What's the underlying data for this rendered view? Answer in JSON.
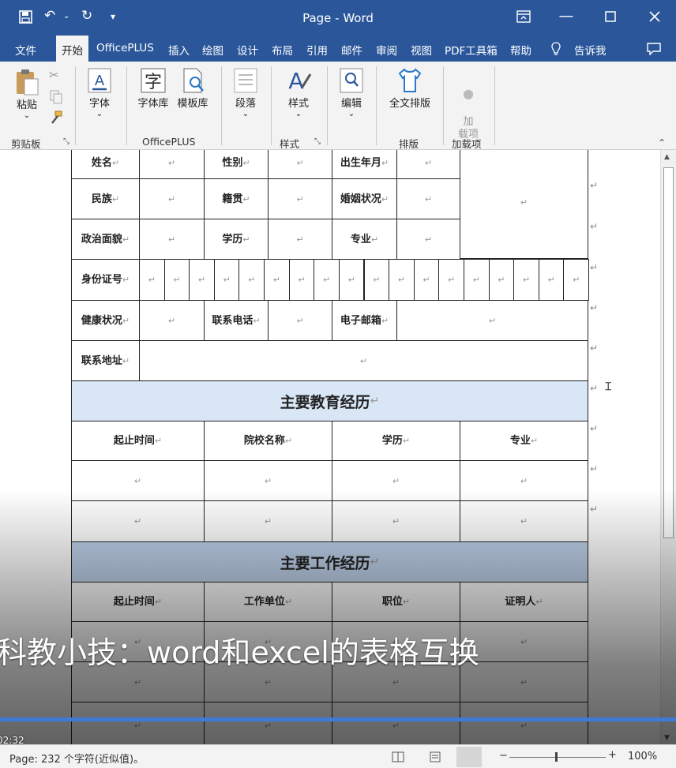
{
  "titlebar": {
    "title": "Page - Word",
    "save_icon": "save-icon",
    "undo_icon": "undo-icon",
    "redo_icon": "redo-icon",
    "customize_icon": "customize-qat-icon",
    "ribbon_display_icon": "ribbon-display-options-icon",
    "minimize_icon": "minimize-icon",
    "maximize_icon": "maximize-icon",
    "close_icon": "close-icon"
  },
  "tabs": [
    "文件",
    "开始",
    "OfficePLUS",
    "插入",
    "绘图",
    "设计",
    "布局",
    "引用",
    "邮件",
    "审阅",
    "视图",
    "PDF工具箱",
    "帮助"
  ],
  "active_tab": "开始",
  "tell_me": "告诉我",
  "ribbon": {
    "paste": "粘贴",
    "clipboard_group": "剪贴板",
    "font": "字体",
    "font_lib": "字体库",
    "template_lib": "模板库",
    "officeplus_group": "OfficePLUS",
    "paragraph": "段落",
    "styles": "样式",
    "styles_group": "样式",
    "editing": "编辑",
    "full_layout": "全文排版",
    "layout_group": "排版",
    "addins": "加\n载项",
    "addins_group": "加载项"
  },
  "table": {
    "personal_rows": [
      [
        "姓名",
        "性别",
        "出生年月"
      ],
      [
        "民族",
        "籍贯",
        "婚姻状况"
      ],
      [
        "政治面貌",
        "学历",
        "专业"
      ]
    ],
    "id_label": "身份证号",
    "health_label": "健康状况",
    "phone_label": "联系电话",
    "email_label": "电子邮箱",
    "address_label": "联系地址",
    "edu_title": "主要教育经历",
    "edu_headers": [
      "起止时间",
      "院校名称",
      "学历",
      "专业"
    ],
    "work_title": "主要工作经历",
    "work_headers": [
      "起止时间",
      "工作单位",
      "职位",
      "证明人"
    ],
    "paragraph_mark": "↵"
  },
  "status": {
    "page_info": "Page: 232 个字符(近似值)。",
    "zoom": "100%"
  },
  "video": {
    "caption": "科教小技：word和excel的表格互换",
    "time": "02:32"
  },
  "colors": {
    "word_blue": "#2b579a",
    "edu_band": "#d9e6f6",
    "work_band": "#bfd2ea",
    "progress": "#3d7bd6"
  }
}
